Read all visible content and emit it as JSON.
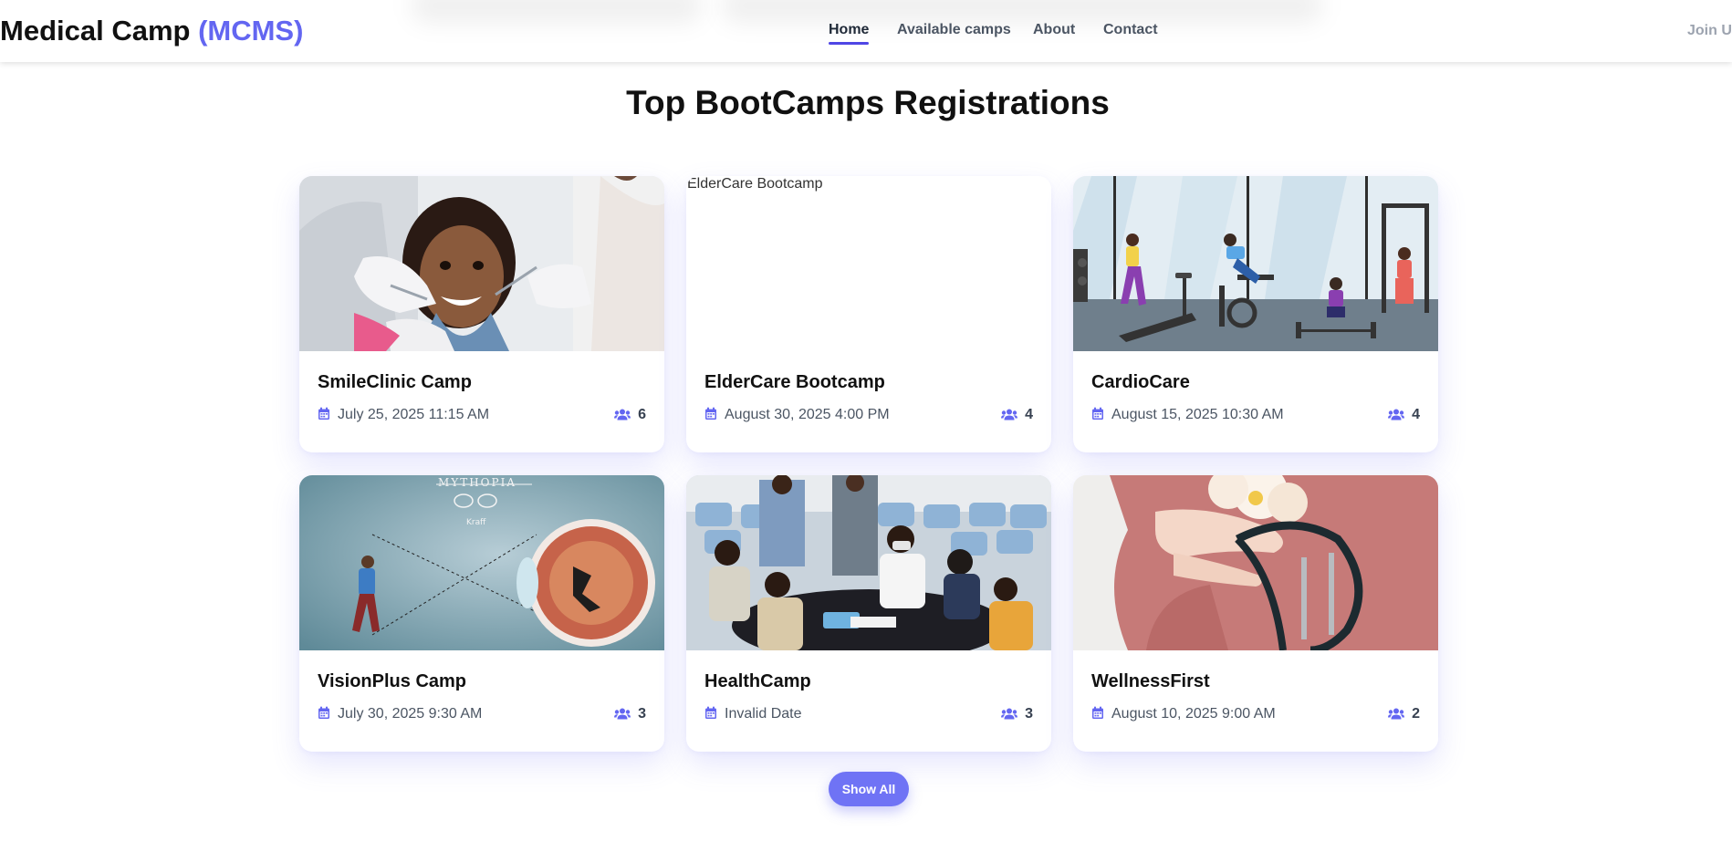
{
  "header": {
    "brand_main": "Medical Camp ",
    "brand_accent": "(MCMS)",
    "nav": [
      "Home",
      "Available camps",
      "About",
      "Contact"
    ],
    "active": "Home",
    "join_label": "Join Us"
  },
  "section": {
    "title": "Top BootCamps Registrations"
  },
  "cards": [
    {
      "title": "SmileClinic Camp",
      "date": "July 25, 2025 11:15 AM",
      "count": "6",
      "image": "dental-checkup-photo"
    },
    {
      "title": "ElderCare Bootcamp",
      "date": "August 30, 2025 4:00 PM",
      "count": "4",
      "image": "broken-image",
      "alt": "ElderCare Bootcamp"
    },
    {
      "title": "CardioCare",
      "date": "August 15, 2025 10:30 AM",
      "count": "4",
      "image": "gym-illustration"
    },
    {
      "title": "VisionPlus Camp",
      "date": "July 30, 2025 9:30 AM",
      "count": "3",
      "image": "eye-optics-illustration"
    },
    {
      "title": "HealthCamp",
      "date": "Invalid Date",
      "count": "3",
      "image": "health-camp-photo"
    },
    {
      "title": "WellnessFirst",
      "date": "August 10, 2025 9:00 AM",
      "count": "2",
      "image": "stethoscope-photo"
    }
  ],
  "show_all_label": "Show All",
  "colors": {
    "accent": "#6366f1",
    "button": "#6f73f5"
  }
}
